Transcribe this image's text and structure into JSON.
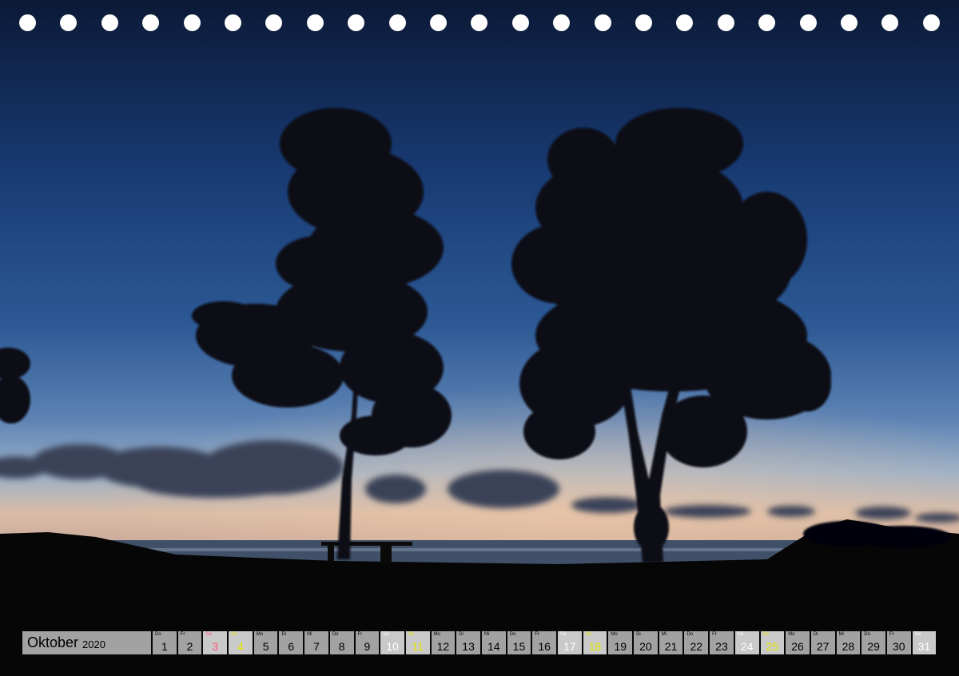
{
  "calendar": {
    "month": "Oktober",
    "year": "2020",
    "days": [
      {
        "wd": "Do",
        "d": "1",
        "t": ""
      },
      {
        "wd": "Fr",
        "d": "2",
        "t": ""
      },
      {
        "wd": "Sa",
        "d": "3",
        "t": "hol"
      },
      {
        "wd": "So",
        "d": "4",
        "t": "sun"
      },
      {
        "wd": "Mo",
        "d": "5",
        "t": ""
      },
      {
        "wd": "Di",
        "d": "6",
        "t": ""
      },
      {
        "wd": "Mi",
        "d": "7",
        "t": ""
      },
      {
        "wd": "Do",
        "d": "8",
        "t": ""
      },
      {
        "wd": "Fr",
        "d": "9",
        "t": ""
      },
      {
        "wd": "Sa",
        "d": "10",
        "t": "sat"
      },
      {
        "wd": "So",
        "d": "11",
        "t": "sun"
      },
      {
        "wd": "Mo",
        "d": "12",
        "t": ""
      },
      {
        "wd": "Di",
        "d": "13",
        "t": ""
      },
      {
        "wd": "Mi",
        "d": "14",
        "t": ""
      },
      {
        "wd": "Do",
        "d": "15",
        "t": ""
      },
      {
        "wd": "Fr",
        "d": "16",
        "t": ""
      },
      {
        "wd": "Sa",
        "d": "17",
        "t": "sat"
      },
      {
        "wd": "So",
        "d": "18",
        "t": "sun"
      },
      {
        "wd": "Mo",
        "d": "19",
        "t": ""
      },
      {
        "wd": "Di",
        "d": "20",
        "t": ""
      },
      {
        "wd": "Mi",
        "d": "21",
        "t": ""
      },
      {
        "wd": "Do",
        "d": "22",
        "t": ""
      },
      {
        "wd": "Fr",
        "d": "23",
        "t": ""
      },
      {
        "wd": "Sa",
        "d": "24",
        "t": "sat"
      },
      {
        "wd": "So",
        "d": "25",
        "t": "sun"
      },
      {
        "wd": "Mo",
        "d": "26",
        "t": ""
      },
      {
        "wd": "Di",
        "d": "27",
        "t": ""
      },
      {
        "wd": "Mi",
        "d": "28",
        "t": ""
      },
      {
        "wd": "Do",
        "d": "29",
        "t": ""
      },
      {
        "wd": "Fr",
        "d": "30",
        "t": ""
      },
      {
        "wd": "Sa",
        "d": "31",
        "t": "sat"
      }
    ]
  },
  "colors": {
    "sky_top": "#0c1a3c",
    "sky_mid": "#2f5b96",
    "horizon": "#d3b6a0",
    "cell": "#a2a2a2",
    "weekend_cell": "#c9c9c9",
    "holiday_text": "#ff5a78",
    "sunday_text": "#e6e600"
  }
}
